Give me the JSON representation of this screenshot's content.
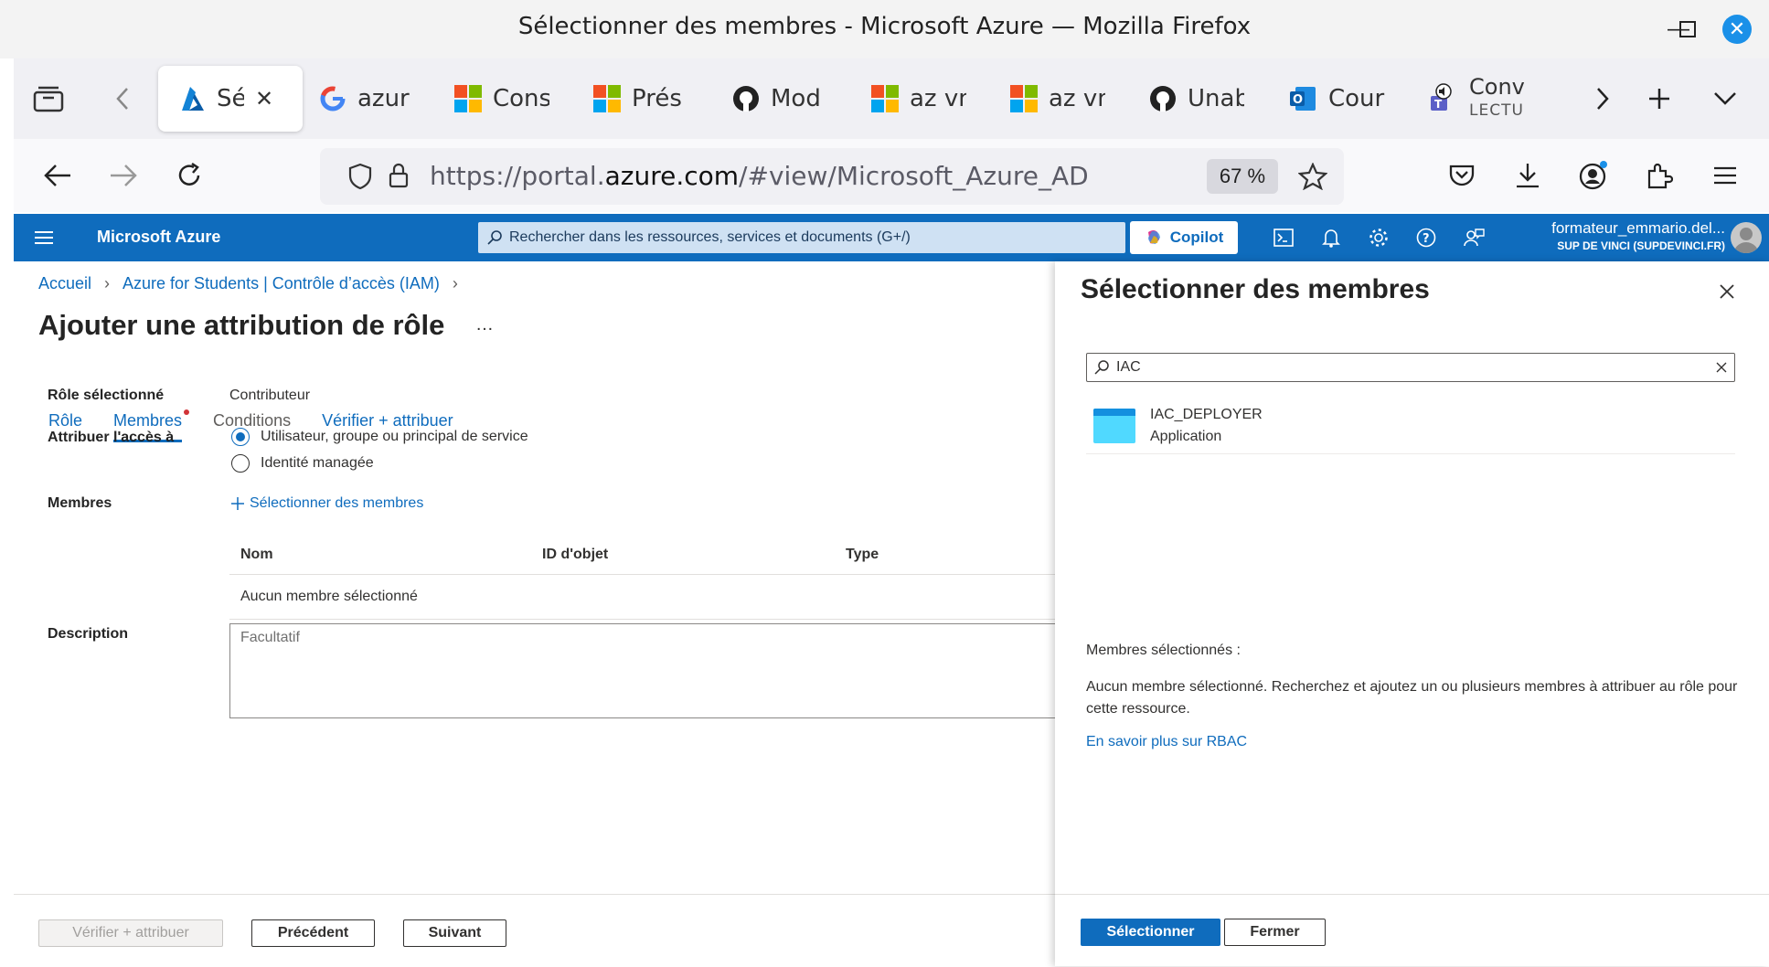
{
  "window": {
    "title": "Sélectionner des membres - Microsoft Azure — Mozilla Firefox",
    "minimize": "—",
    "maximize": "☐",
    "close": "✕"
  },
  "tabs": [
    {
      "label": "Sél",
      "icon": "azure-icon",
      "active": true,
      "close": "✕"
    },
    {
      "label": "azur",
      "icon": "google-icon"
    },
    {
      "label": "Cons",
      "icon": "microsoft-icon"
    },
    {
      "label": "Prés",
      "icon": "microsoft-icon"
    },
    {
      "label": "Mod",
      "icon": "github-icon"
    },
    {
      "label": "az vn",
      "icon": "microsoft-icon"
    },
    {
      "label": "az vn",
      "icon": "microsoft-icon"
    },
    {
      "label": "Unab",
      "icon": "github-icon"
    },
    {
      "label": "Cour",
      "icon": "outlook-icon"
    },
    {
      "label": "Conv",
      "sublabel": "LECTU",
      "icon": "teams-icon"
    }
  ],
  "navbar": {
    "url_prefix": "https://portal.",
    "url_domain": "azure.com",
    "url_rest": "/#view/Microsoft_Azure_AD/AddRoleAss",
    "zoom": "67 %"
  },
  "azure": {
    "brand": "Microsoft Azure",
    "search_placeholder": "Rechercher dans les ressources, services et documents (G+/)",
    "copilot": "Copilot",
    "user_name": "formateur_emmario.del...",
    "user_org": "SUP DE VINCI (SUPDEVINCI.FR)"
  },
  "breadcrumb": [
    "Accueil",
    "Azure for Students | Contrôle d’accès (IAM)"
  ],
  "page": {
    "title": "Ajouter une attribution de rôle",
    "more": "…"
  },
  "steps": [
    {
      "label": "Rôle"
    },
    {
      "label": "Membres",
      "active": true
    },
    {
      "label": "Conditions",
      "muted": true
    },
    {
      "label": "Vérifier + attribuer"
    }
  ],
  "form": {
    "role_label": "Rôle sélectionné",
    "role_value": "Contributeur",
    "assign_label": "Attribuer l'accès à",
    "option1": "Utilisateur, groupe ou principal de service",
    "option2": "Identité managée",
    "members_label": "Membres",
    "select_members": "Sélectionner des membres",
    "columns": [
      "Nom",
      "ID d'objet",
      "Type"
    ],
    "empty_row": "Aucun membre sélectionné",
    "description_label": "Description",
    "description_placeholder": "Facultatif"
  },
  "footer": {
    "review": "Vérifier + attribuer",
    "previous": "Précédent",
    "next": "Suivant"
  },
  "panel": {
    "title": "Sélectionner des membres",
    "search_value": "IAC",
    "result_name": "IAC_DEPLOYER",
    "result_type": "Application",
    "selected_heading": "Membres sélectionnés :",
    "selected_info": "Aucun membre sélectionné. Recherchez et ajoutez un ou plusieurs membres à attribuer au rôle pour cette ressource.",
    "learn_more": "En savoir plus sur RBAC",
    "select_button": "Sélectionner",
    "close_button": "Fermer"
  },
  "colors": {
    "azure_blue": "#0f6cbd",
    "firefox_close": "#1a90e8"
  }
}
